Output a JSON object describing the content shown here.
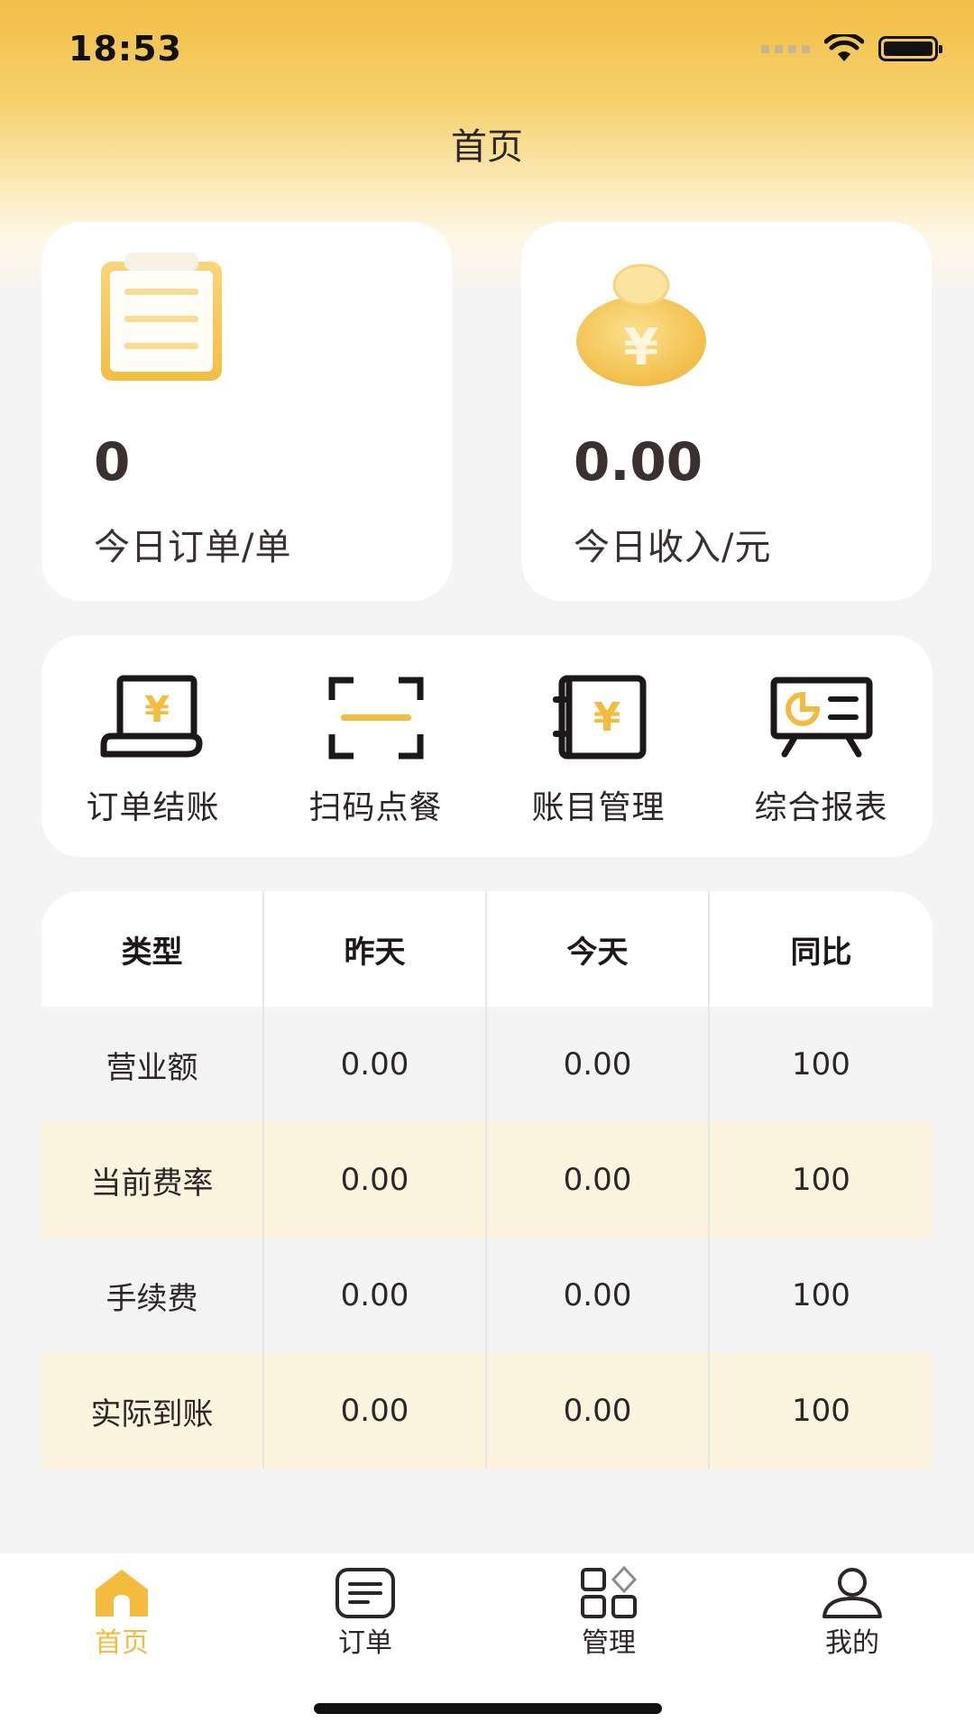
{
  "status_bar": {
    "time": "18:53"
  },
  "header": {
    "title": "首页"
  },
  "stats": [
    {
      "value": "0",
      "label": "今日订单/单",
      "icon": "clipboard-icon"
    },
    {
      "value": "0.00",
      "label": "今日收入/元",
      "icon": "coin-bag-icon"
    }
  ],
  "actions": [
    {
      "label": "订单结账",
      "icon": "checkout-icon"
    },
    {
      "label": "扫码点餐",
      "icon": "scan-icon"
    },
    {
      "label": "账目管理",
      "icon": "ledger-icon"
    },
    {
      "label": "综合报表",
      "icon": "report-icon"
    }
  ],
  "table": {
    "headers": [
      "类型",
      "昨天",
      "今天",
      "同比"
    ],
    "rows": [
      [
        "营业额",
        "0.00",
        "0.00",
        "100"
      ],
      [
        "当前费率",
        "0.00",
        "0.00",
        "100"
      ],
      [
        "手续费",
        "0.00",
        "0.00",
        "100"
      ],
      [
        "实际到账",
        "0.00",
        "0.00",
        "100"
      ]
    ]
  },
  "tabs": [
    {
      "label": "首页",
      "icon": "home-icon",
      "active": true
    },
    {
      "label": "订单",
      "icon": "order-icon",
      "active": false
    },
    {
      "label": "管理",
      "icon": "manage-icon",
      "active": false
    },
    {
      "label": "我的",
      "icon": "profile-icon",
      "active": false
    }
  ],
  "colors": {
    "accent": "#f3bc3f",
    "text": "#2d2626",
    "row_alt": "#fcf4df",
    "row_base": "#f4f4f4"
  }
}
